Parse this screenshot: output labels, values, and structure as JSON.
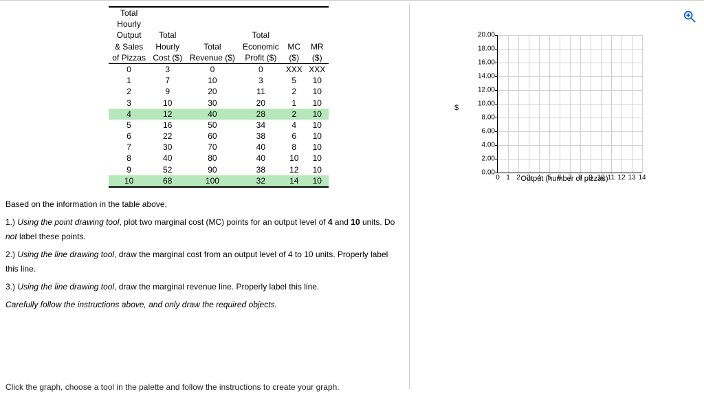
{
  "table": {
    "headers": [
      "Total Hourly Output & Sales of Pizzas",
      "Total Hourly Cost ($)",
      "Total Revenue ($)",
      "Total Economic Profit ($)",
      "MC ($)",
      "MR ($)"
    ],
    "rows": [
      {
        "hl": false,
        "cells": [
          "0",
          "3",
          "0",
          "0",
          "XXX",
          "XXX"
        ]
      },
      {
        "hl": false,
        "cells": [
          "1",
          "7",
          "10",
          "3",
          "5",
          "10"
        ]
      },
      {
        "hl": false,
        "cells": [
          "2",
          "9",
          "20",
          "11",
          "2",
          "10"
        ]
      },
      {
        "hl": false,
        "cells": [
          "3",
          "10",
          "30",
          "20",
          "1",
          "10"
        ]
      },
      {
        "hl": true,
        "cells": [
          "4",
          "12",
          "40",
          "28",
          "2",
          "10"
        ],
        "bold": [
          1,
          4,
          5
        ]
      },
      {
        "hl": false,
        "cells": [
          "5",
          "16",
          "50",
          "34",
          "4",
          "10"
        ]
      },
      {
        "hl": false,
        "cells": [
          "6",
          "22",
          "60",
          "38",
          "6",
          "10"
        ],
        "bold": [
          1
        ]
      },
      {
        "hl": false,
        "cells": [
          "7",
          "30",
          "70",
          "40",
          "8",
          "10"
        ]
      },
      {
        "hl": false,
        "cells": [
          "8",
          "40",
          "80",
          "40",
          "10",
          "10"
        ]
      },
      {
        "hl": false,
        "cells": [
          "9",
          "52",
          "90",
          "38",
          "12",
          "10"
        ],
        "bold": [
          1
        ]
      },
      {
        "hl": true,
        "cells": [
          "10",
          "68",
          "100",
          "32",
          "14",
          "10"
        ],
        "bold": [
          1,
          4,
          5
        ]
      }
    ]
  },
  "instr": {
    "intro": "Based on the information in the table above,",
    "p1_a": "1.) ",
    "p1_b": "Using the point drawing tool",
    "p1_c": ", plot two marginal cost (MC) points for an output level of ",
    "p1_d": "4",
    "p1_e": " and ",
    "p1_f": "10",
    "p1_g": " units. Do ",
    "p1_h": "not",
    "p1_i": " label these points.",
    "p2_a": "2.) ",
    "p2_b": "Using the line drawing tool",
    "p2_c": ", draw the marginal cost from an output level of 4 to 10 units. Properly label this line.",
    "p3_a": "3.) ",
    "p3_b": "Using the line drawing tool",
    "p3_c": ", draw the  marginal revenue line. Properly label this line.",
    "p4": "Carefully follow the instructions above, and only draw the required objects."
  },
  "bottom_hint": "Click the graph, choose a tool in the palette and follow the instructions to create your graph.",
  "chart_data": {
    "type": "scatter",
    "title": "",
    "xlabel": "Output (number of pizzas)",
    "ylabel": "$",
    "xlim": [
      0,
      14
    ],
    "ylim": [
      0,
      20
    ],
    "x_ticks": [
      0,
      1,
      2,
      3,
      4,
      5,
      6,
      7,
      8,
      9,
      10,
      11,
      12,
      13,
      14
    ],
    "y_ticks": [
      0,
      2,
      4,
      6,
      8,
      10,
      12,
      14,
      16,
      18,
      20
    ],
    "y_tick_labels": [
      "0.00",
      "2.00",
      "4.00",
      "6.00",
      "8.00",
      "10.00",
      "12.00",
      "14.00",
      "16.00",
      "18.00",
      "20.00"
    ],
    "series": []
  }
}
